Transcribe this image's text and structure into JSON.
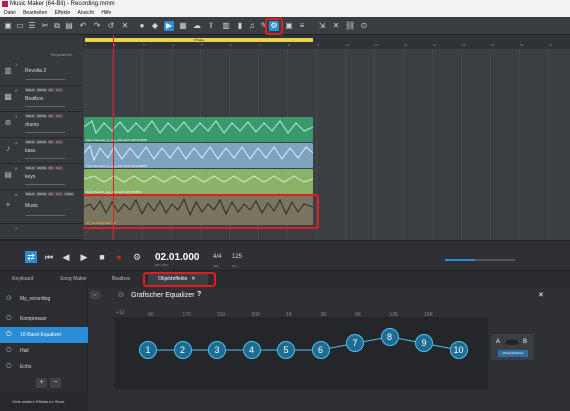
{
  "app": {
    "title": "Music Maker (64-Bit) - Recording.mmm"
  },
  "menu": [
    "Datei",
    "Bearbeiten",
    "Effekte",
    "Ansicht",
    "Hilfe"
  ],
  "toolbar": {
    "highlighted_button": "object-effects-button"
  },
  "timeline": {
    "section_label": "8 Takte",
    "tempo_label": "Tempoänder.",
    "ticks": [
      "1",
      "2",
      "3",
      "4",
      "5",
      "6",
      "7",
      "8",
      "9",
      "10",
      "11",
      "12",
      "13",
      "14",
      "15",
      "16",
      "17",
      "18"
    ]
  },
  "tracks": [
    {
      "num": "1",
      "name": "Revolta 2",
      "icon": "keyboard-icon"
    },
    {
      "num": "2",
      "name": "Beatbox",
      "icon": "drum-pads-icon"
    },
    {
      "num": "3",
      "name": "drums",
      "icon": "drums-icon"
    },
    {
      "num": "4",
      "name": "bass",
      "icon": "bass-guitar-icon"
    },
    {
      "num": "5",
      "name": "keys",
      "icon": "keys-icon"
    },
    {
      "num": "6",
      "name": "Music",
      "icon": "music-icon"
    },
    {
      "num": "7",
      "name": "",
      "icon": ""
    }
  ],
  "track_buttons": {
    "solo": "SOLO",
    "mute": "MUTE",
    "fx": "FX",
    "rec": "REC",
    "lock": "LOCK"
  },
  "clips": [
    {
      "label": "Kitty Computer_8_ogg_001.HDP 125.00 BPM",
      "color": "#3a9a6e"
    },
    {
      "label": "Kitty Computer_8_ogg_001.HDP 125.00 BPM",
      "color": "#7da3c0"
    },
    {
      "label": "Bright Bass 8_ogg_001.HDP 125.00 BPM",
      "color": "#8ab36a"
    },
    {
      "label": "My_recording.HDP 4/2",
      "color": "#d9842b"
    }
  ],
  "transport": {
    "time": "02.01.000",
    "time_sub": "Bar: 00:07",
    "signature": "4/4",
    "signature_label": "Takt",
    "tempo": "125",
    "tempo_label": "bpm"
  },
  "tabs": [
    {
      "label": "Keyboard",
      "icon": "keyboard-icon"
    },
    {
      "label": "Song Maker",
      "icon": "music-note-icon"
    },
    {
      "label": "Beatbox",
      "icon": "drum-pads-icon"
    },
    {
      "label": "Objekteffekte",
      "icon": "effects-icon",
      "active": true
    }
  ],
  "panel": {
    "object_name": "My_recording",
    "effects": [
      {
        "label": "Kompressor",
        "selected": false
      },
      {
        "label": "10-Band-Equalizer",
        "selected": true
      },
      {
        "label": "Hall",
        "selected": false
      },
      {
        "label": "Echo",
        "selected": false
      }
    ],
    "add_label": "+",
    "remove_label": "−",
    "store_label": "Viele weitere Effekte im Store",
    "eq_title": "Grafischer Equalizer",
    "help_label": "?",
    "close_label": "✕",
    "db_label": "+12",
    "freq_labels": [
      "60",
      "170",
      "310",
      "600",
      "1K",
      "3K",
      "6K",
      "12K",
      "16K"
    ],
    "bands": [
      {
        "label": "1",
        "gain": 0
      },
      {
        "label": "2",
        "gain": 0
      },
      {
        "label": "3",
        "gain": 0
      },
      {
        "label": "4",
        "gain": 0
      },
      {
        "label": "5",
        "gain": 0
      },
      {
        "label": "6",
        "gain": 0
      },
      {
        "label": "7",
        "gain": 3
      },
      {
        "label": "8",
        "gain": 6
      },
      {
        "label": "9",
        "gain": 3
      },
      {
        "label": "10",
        "gain": 0
      }
    ],
    "ab_a": "A",
    "ab_b": "B",
    "ab_button": "Vorher/Nachher"
  },
  "colors": {
    "accent": "#2a8bd6",
    "highlight": "#e01e1e",
    "timeline": "#e8d24a"
  }
}
